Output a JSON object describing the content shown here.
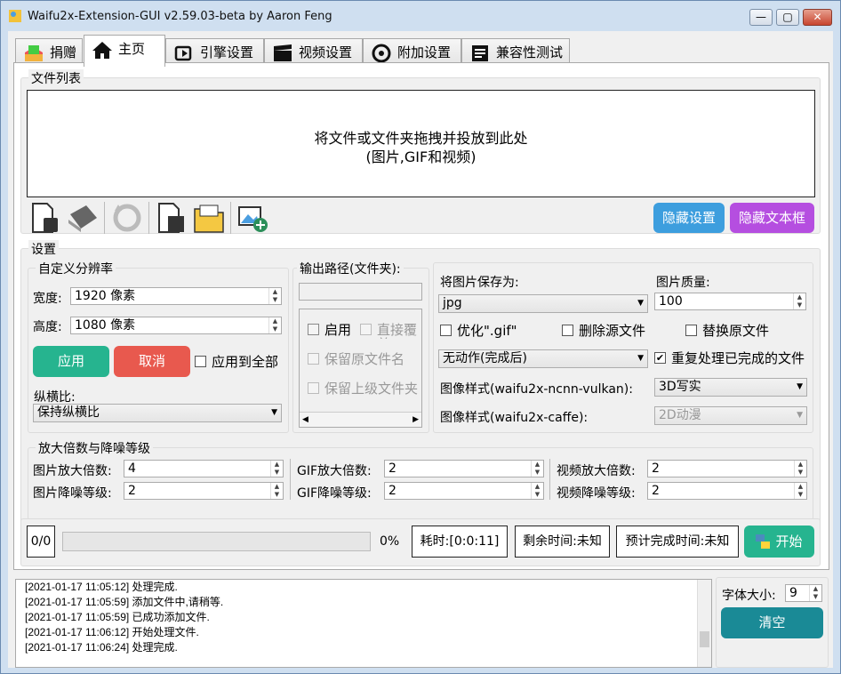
{
  "window": {
    "title": "Waifu2x-Extension-GUI v2.59.03-beta by Aaron Feng",
    "controls": {
      "minimize": "—",
      "maximize": "▢",
      "close": "✕"
    }
  },
  "tabs": [
    {
      "label": "捐赠",
      "icon": "donate-icon"
    },
    {
      "label": "主页",
      "icon": "home-icon"
    },
    {
      "label": "引擎设置",
      "icon": "engine-icon"
    },
    {
      "label": "视频设置",
      "icon": "video-icon"
    },
    {
      "label": "附加设置",
      "icon": "addon-icon"
    },
    {
      "label": "兼容性测试",
      "icon": "compat-icon"
    }
  ],
  "filelist": {
    "title": "文件列表",
    "line1": "将文件或文件夹拖拽并投放到此处",
    "line2": "(图片,GIF和视频)",
    "hide_settings": "隐藏设置",
    "hide_textbox": "隐藏文本框"
  },
  "settings": {
    "title": "设置",
    "resolution": {
      "title": "自定义分辨率",
      "width_label": "宽度:",
      "width_value": "1920 像素",
      "height_label": "高度:",
      "height_value": "1080 像素",
      "apply": "应用",
      "cancel": "取消",
      "apply_all": "应用到全部",
      "ratio_label": "纵横比:",
      "ratio_value": "保持纵横比"
    },
    "output": {
      "title": "输出路径(文件夹):",
      "enable": "启用",
      "overwrite": "直接覆盖",
      "keep_name": "保留原文件名",
      "keep_parent": "保留上级文件夹"
    },
    "save": {
      "save_as_label": "将图片保存为:",
      "format": "jpg",
      "quality_label": "图片质量:",
      "quality": "100",
      "optimize_gif": "优化\".gif\"",
      "delete_src": "删除源文件",
      "replace_src": "替换原文件",
      "after": "无动作(完成后)",
      "reprocess": "重复处理已完成的文件",
      "style_vulkan_label": "图像样式(waifu2x-ncnn-vulkan):",
      "style_vulkan": "3D写实",
      "style_caffe_label": "图像样式(waifu2x-caffe):",
      "style_caffe": "2D动漫"
    },
    "scale": {
      "title": "放大倍数与降噪等级",
      "img_scale_label": "图片放大倍数:",
      "img_scale": "4",
      "img_denoise_label": "图片降噪等级:",
      "img_denoise": "2",
      "gif_scale_label": "GIF放大倍数:",
      "gif_scale": "2",
      "gif_denoise_label": "GIF降噪等级:",
      "gif_denoise": "2",
      "vid_scale_label": "视频放大倍数:",
      "vid_scale": "2",
      "vid_denoise_label": "视频降噪等级:",
      "vid_denoise": "2"
    }
  },
  "progress": {
    "count": "0/0",
    "percent": "0%",
    "percent_value": 0,
    "elapsed": "耗时:[0:0:11]",
    "remaining": "剩余时间:未知",
    "eta": "预计完成时间:未知",
    "start": "开始"
  },
  "log": [
    "[2021-01-17 11:05:12] 处理完成.",
    "[2021-01-17 11:05:59] 添加文件中,请稍等.",
    "[2021-01-17 11:05:59] 已成功添加文件.",
    "[2021-01-17 11:06:12] 开始处理文件.",
    "[2021-01-17 11:06:24] 处理完成."
  ],
  "font": {
    "label": "字体大小:",
    "value": "9",
    "clear": "清空"
  },
  "colors": {
    "teal": "#26b48f",
    "red": "#e8594e",
    "blue": "#3d9ede",
    "purple": "#b54ee0",
    "darkteal": "#1a8a96"
  }
}
